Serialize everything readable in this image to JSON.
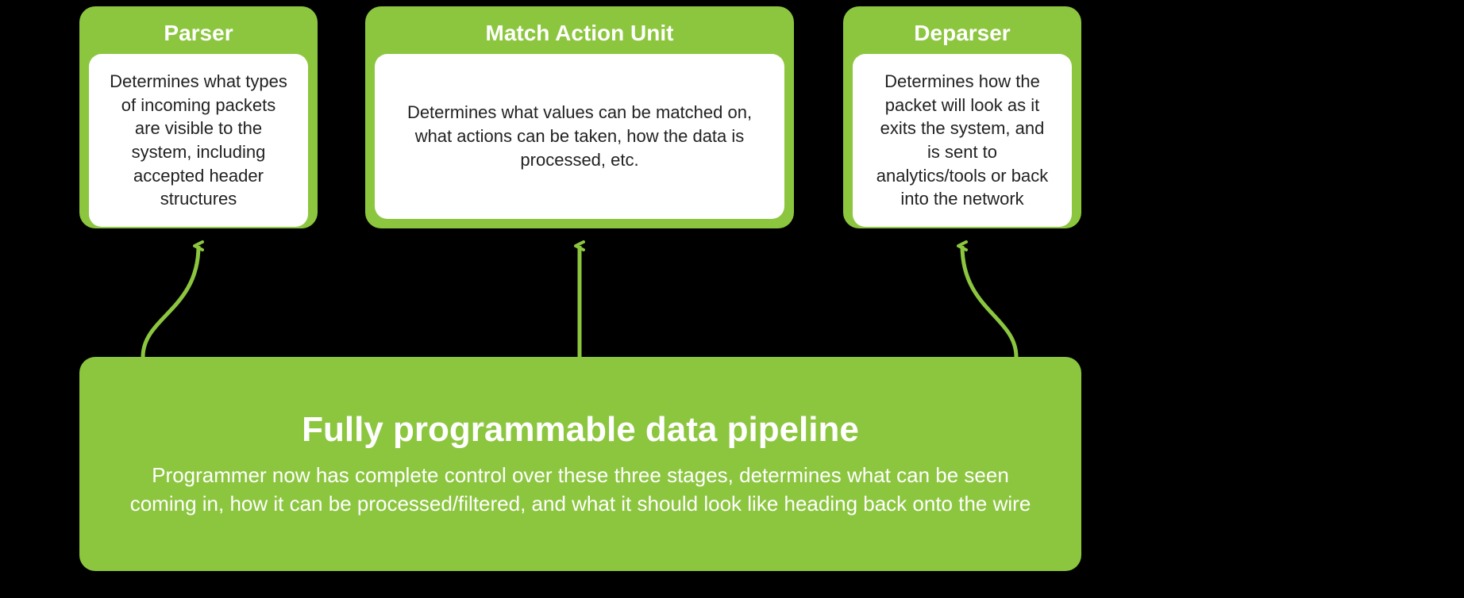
{
  "cards": {
    "parser": {
      "title": "Parser",
      "desc": "Determines what types of incoming packets are visible to the system, including accepted header structures"
    },
    "mau": {
      "title": "Match Action Unit",
      "desc": "Determines what values can be matched on, what actions can be taken, how the data is processed, etc."
    },
    "deparser": {
      "title": "Deparser",
      "desc": "Determines how the packet will look as it exits the system, and is sent to analytics/tools or back into the network"
    }
  },
  "bottom": {
    "title": "Fully programmable data pipeline",
    "desc": "Programmer now has complete control over these three stages, determines what can be seen coming in, how it can be processed/filtered, and what it should look like heading back onto the wire"
  },
  "colors": {
    "accent": "#8cc63f",
    "background": "#000000",
    "cardBody": "#ffffff",
    "text": "#222222"
  }
}
